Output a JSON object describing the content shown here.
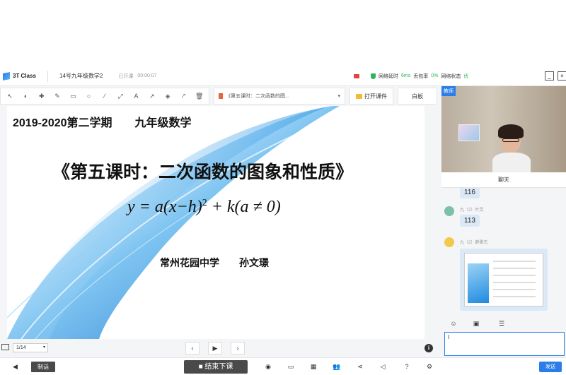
{
  "app": {
    "brand": "3T Class",
    "course_title": "14号九年级数学2",
    "class_status": "已开课",
    "timer": "00:00:07"
  },
  "network": {
    "latency_label": "网络延时",
    "latency_value": "6ms",
    "loss_label": "丢包率",
    "loss_value": "0%",
    "state_label": "网络状态",
    "state_value": "优"
  },
  "window": {
    "minimize": "_",
    "close": "×"
  },
  "toolbar": {
    "tools": [
      "pointer-icon",
      "palette-icon",
      "crosshair-icon",
      "pen-icon",
      "rectangle-icon",
      "circle-icon",
      "line-icon",
      "arrow-line-icon",
      "text-icon",
      "arrow-icon",
      "eraser-icon",
      "laser-icon",
      "trash-icon"
    ],
    "glyphs": [
      "↖",
      "◐",
      "✚",
      "✎",
      "▭",
      "○",
      "⁄",
      "⤢",
      "A",
      "↗",
      "◈",
      "⤤",
      "🗑"
    ],
    "file_name": "《第五课时：二次函数的图...",
    "open_button": "打开课件",
    "whiteboard_button": "白板"
  },
  "slide": {
    "semester": "2019-2020第二学期　　九年级数学",
    "title": "《第五课时：二次函数的图象和性质》",
    "formula_main": "y = a(x−h)",
    "formula_exp": "2",
    "formula_tail": " + k(a ≠ 0)",
    "school": "常州花园中学　　孙文璟"
  },
  "pager": {
    "page": "1/14",
    "prev": "‹",
    "play": "▶",
    "next": "›",
    "info": "i"
  },
  "bottombar": {
    "volume_icon": "◀",
    "mute_label": "制话",
    "end_class": "■ 结束下课",
    "send": "发送"
  },
  "video": {
    "role_badge": "教师"
  },
  "chat": {
    "tab_label": "聊天",
    "messages": [
      {
        "sender": "",
        "text": "116"
      },
      {
        "sender": "九（2）叶灵",
        "text": "113"
      },
      {
        "sender": "九（2）薛雅杰",
        "text": ""
      }
    ],
    "input_value": "I"
  },
  "colors": {
    "accent": "#2b7de9",
    "good": "#2fb35b",
    "dark_button": "#4a4a4a"
  }
}
